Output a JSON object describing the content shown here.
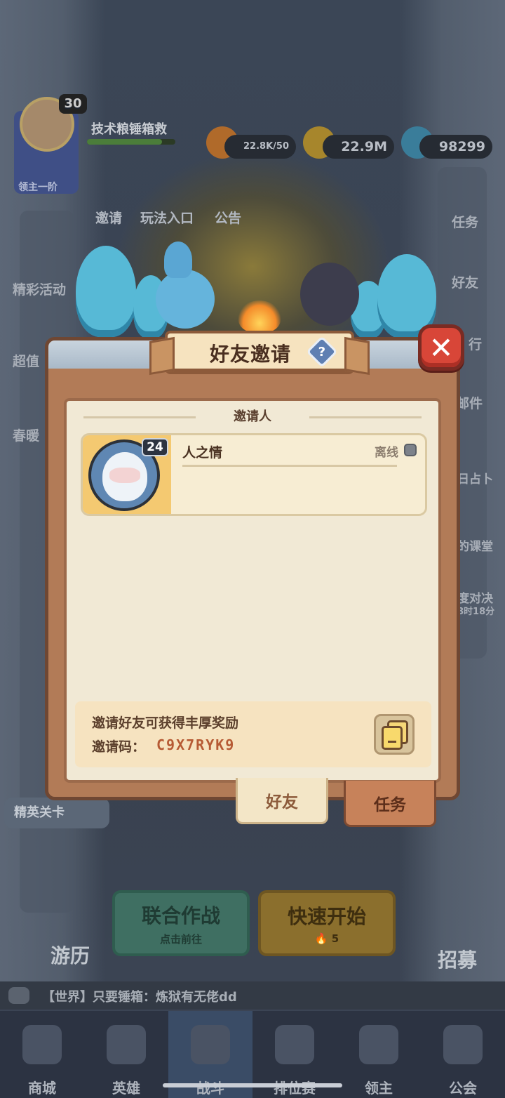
{
  "header": {
    "player_level": "30",
    "lord_rank": "领主一阶",
    "player_name": "技术粮锤箱救",
    "xp_progress": 0.85,
    "resources": [
      {
        "name": "stamina",
        "value": "22.8K/50",
        "icon": "fire-drop-icon"
      },
      {
        "name": "gold",
        "value": "22.9M",
        "icon": "gold-coin-icon"
      },
      {
        "name": "gems",
        "value": "98299",
        "icon": "blue-crystal-icon"
      }
    ]
  },
  "top_links": [
    "邀请",
    "玩法入口",
    "公告"
  ],
  "left_links": [
    "精彩活动",
    "超值",
    "春暖"
  ],
  "right_links": [
    "任务",
    "好友",
    "行",
    "邮件",
    "日占卜",
    "的课堂",
    "度对决",
    "8时18分"
  ],
  "popup": {
    "title": "好友邀请",
    "help_symbol": "?",
    "close_symbol": "✕",
    "section_title": "邀请人",
    "friend": {
      "name": "人之情",
      "level": "24",
      "status": "离线"
    },
    "invite_text": "邀请好友可获得丰厚奖励",
    "invite_code_label": "邀请码：",
    "invite_code": "C9X7RYK9",
    "tabs": [
      "好友",
      "任务"
    ]
  },
  "hud": {
    "elite_card": "精英关卡",
    "coop_main": "联合作战",
    "coop_sub": "点击前往",
    "quick_main": "快速开始",
    "quick_cost": "5",
    "travel": "游历",
    "recruit": "招募",
    "chat": "【世界】只要锤箱：炼狱有无佬dd"
  },
  "nav": [
    {
      "label": "商城",
      "icon": "shop-icon"
    },
    {
      "label": "英雄",
      "icon": "hero-card-icon"
    },
    {
      "label": "战斗",
      "icon": "battle-icon"
    },
    {
      "label": "排位赛",
      "icon": "rank-shield-icon"
    },
    {
      "label": "领主",
      "icon": "lord-banner-icon"
    },
    {
      "label": "公会",
      "icon": "guild-icon"
    }
  ]
}
